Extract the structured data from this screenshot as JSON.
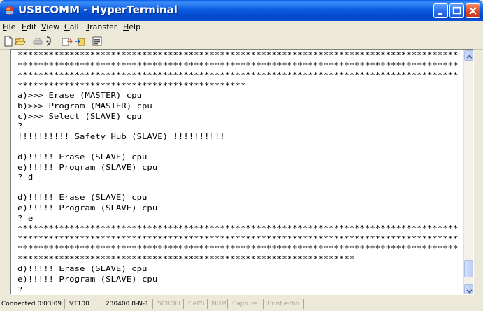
{
  "window": {
    "title": "USBCOMM - HyperTerminal"
  },
  "menu": {
    "file": {
      "u": "F",
      "rest": "ile"
    },
    "edit": {
      "u": "E",
      "rest": "dit"
    },
    "view": {
      "u": "V",
      "rest": "iew"
    },
    "call": {
      "u": "C",
      "rest": "all"
    },
    "transfer": {
      "u": "T",
      "rest": "ransfer"
    },
    "help": {
      "u": "H",
      "rest": "elp"
    }
  },
  "toolbar": {
    "icons": [
      "new-icon",
      "open-icon",
      "disconnect-icon",
      "dial-icon",
      "send-icon",
      "receive-icon",
      "properties-icon"
    ]
  },
  "terminal": {
    "lines": [
      "**********************************************************************************************",
      "**********************************************************************************************",
      "**********************************************************************************************",
      "********************************************",
      "a)>>> Erase (MASTER) cpu",
      "b)>>> Program (MASTER) cpu",
      "c)>>> Select (SLAVE) cpu",
      "?",
      "!!!!!!!!!! Safety Hub (SLAVE) !!!!!!!!!!",
      "",
      "d)!!!!! Erase (SLAVE) cpu",
      "e)!!!!! Program (SLAVE) cpu",
      "? d",
      "",
      "d)!!!!! Erase (SLAVE) cpu",
      "e)!!!!! Program (SLAVE) cpu",
      "? e",
      "**********************************************************************************************",
      "**********************************************************************************************",
      "**********************************************************************************************",
      "*****************************************************************",
      "d)!!!!! Erase (SLAVE) cpu",
      "e)!!!!! Program (SLAVE) cpu",
      "?"
    ]
  },
  "status": {
    "connected": "Connected 0:03:09",
    "emulation": "VT100",
    "settings": "230400 8-N-1",
    "scroll": "SCROLL",
    "caps": "CAPS",
    "num": "NUM",
    "capture": "Capture",
    "print_echo": "Print echo"
  }
}
